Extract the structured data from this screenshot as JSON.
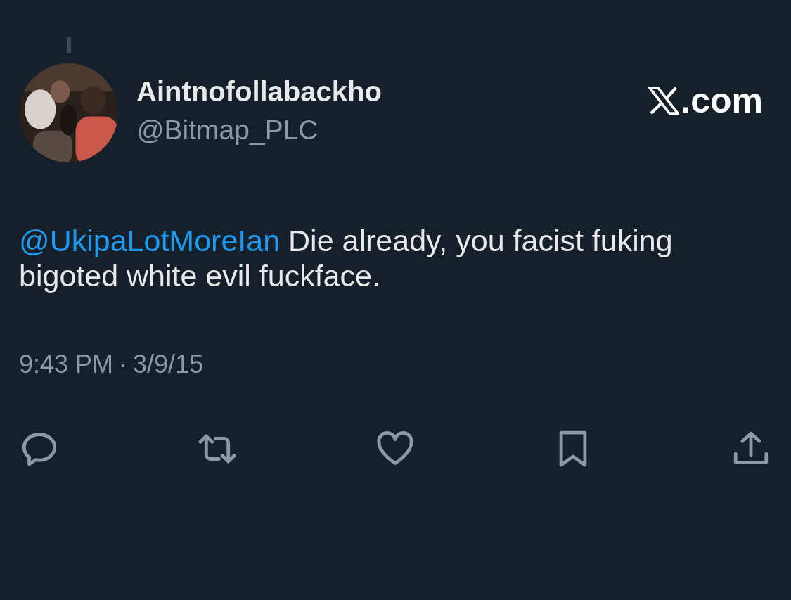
{
  "author": {
    "name": "Aintnofollabackho",
    "handle": "@Bitmap_PLC"
  },
  "brand": {
    "suffix": ".com"
  },
  "tweet": {
    "mention": "@UkipaLotMoreIan",
    "text": " Die already, you facist fuking bigoted white evil fuckface."
  },
  "timestamp": {
    "time": "9:43 PM",
    "separator": "·",
    "date": "3/9/15"
  },
  "actions": [
    {
      "kind": "reply"
    },
    {
      "kind": "repost"
    },
    {
      "kind": "like"
    },
    {
      "kind": "bookmark"
    },
    {
      "kind": "share"
    }
  ]
}
